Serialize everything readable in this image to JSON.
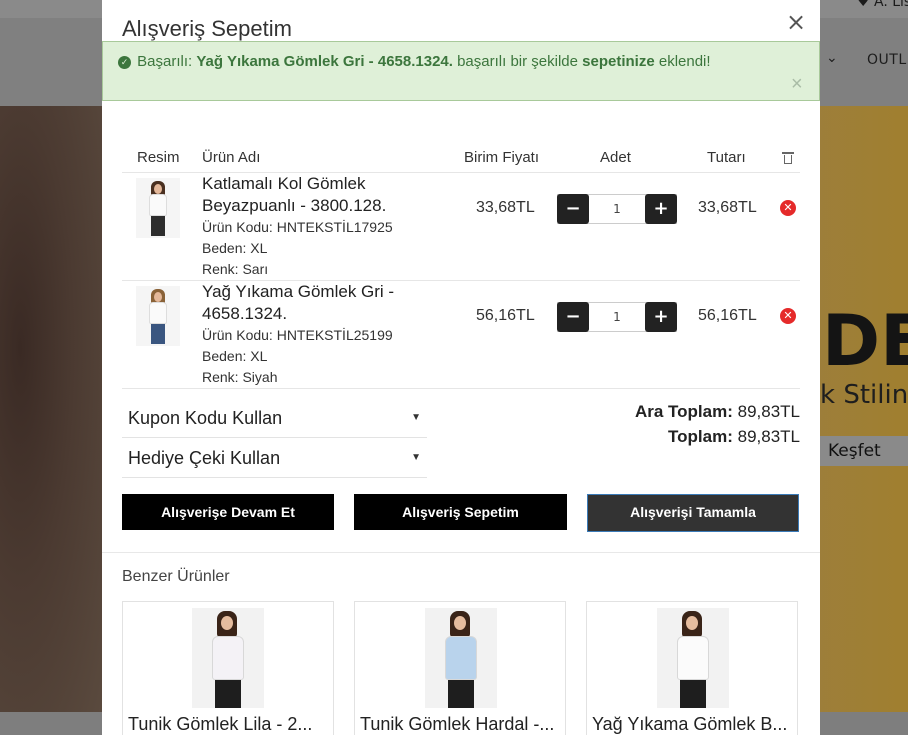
{
  "background": {
    "list_label": "♥ A. Liste",
    "nav_outlet": "OUTLET",
    "nav_chevron": "⌄",
    "hero_big": "DE",
    "hero_sub": "k Stilini",
    "hero_button": "Keşfet"
  },
  "modal": {
    "title": "Alışveriş Sepetim",
    "close": "×"
  },
  "alert": {
    "prefix": "Başarılı:",
    "product": "Yağ Yıkama Gömlek Gri - 4658.1324.",
    "middle": "başarılı bir şekilde",
    "link": "sepetinize",
    "suffix": "eklendi!",
    "close": "×"
  },
  "table": {
    "headers": {
      "image": "Resim",
      "name": "Ürün Adı",
      "unit_price": "Birim Fiyatı",
      "qty": "Adet",
      "total": "Tutarı"
    },
    "items": [
      {
        "name": "Katlamalı Kol Gömlek Beyazpuanlı - 3800.128.",
        "code": "Ürün Kodu: HNTEKSTİL17925",
        "size": "Beden: XL",
        "color": "Renk: Sarı",
        "unit_price": "33,68TL",
        "qty": "1",
        "total": "33,68TL"
      },
      {
        "name": "Yağ Yıkama Gömlek Gri - 4658.1324.",
        "code": "Ürün Kodu: HNTEKSTİL25199",
        "size": "Beden: XL",
        "color": "Renk: Siyah",
        "unit_price": "56,16TL",
        "qty": "1",
        "total": "56,16TL"
      }
    ],
    "minus": "−",
    "plus": "+"
  },
  "coupon": {
    "coupon_label": "Kupon Kodu Kullan",
    "gift_label": "Hediye Çeki Kullan",
    "caret": "▼"
  },
  "totals": {
    "subtotal_label": "Ara Toplam:",
    "subtotal_value": "89,83TL",
    "total_label": "Toplam:",
    "total_value": "89,83TL"
  },
  "actions": {
    "continue": "Alışverişe Devam Et",
    "cart": "Alışveriş Sepetim",
    "checkout": "Alışverişi Tamamla"
  },
  "similar": {
    "title": "Benzer Ürünler",
    "items": [
      {
        "name": "Tunik Gömlek Lila - 2...",
        "shirt_color": "#f4f2f6"
      },
      {
        "name": "Tunik Gömlek Hardal -...",
        "shirt_color": "#b9d3ec"
      },
      {
        "name": "Yağ Yıkama Gömlek B...",
        "shirt_color": "#fbfbfb"
      }
    ]
  },
  "colors": {
    "alert_bg": "#dff0d8",
    "alert_text": "#3c763d",
    "button_black": "#000000",
    "button_dark": "#333333",
    "remove_red": "#e52a2a"
  }
}
